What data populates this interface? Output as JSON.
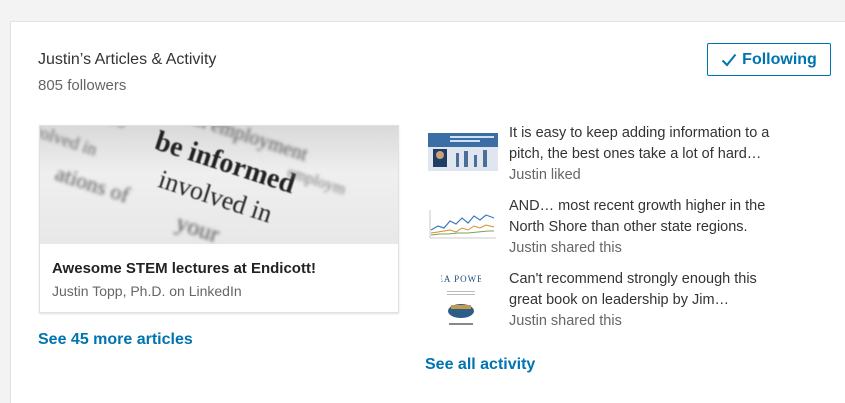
{
  "header": {
    "title": "Justin’s Articles & Activity",
    "followers": "805 followers",
    "follow_button": "Following",
    "follow_icon": "check-icon"
  },
  "featured_article": {
    "image_words": [
      "be informed",
      "involved in",
      "your"
    ],
    "title": "Awesome STEM lectures at Endicott!",
    "author": "Justin Topp, Ph.D. on LinkedIn"
  },
  "see_more_articles": "See 45 more articles",
  "activity": [
    {
      "text_line1": "It is easy to keep adding information to a",
      "text_line2": "pitch, the best ones take a lot of hard…",
      "meta": "Justin liked"
    },
    {
      "text_line1": "AND… most recent growth higher in the",
      "text_line2": "North Shore than other state regions.",
      "meta": "Justin shared this"
    },
    {
      "text_line1": "Can't recommend strongly enough this",
      "text_line2": "great book on leadership by Jim…",
      "meta": "Justin shared this",
      "thumb_text": "SEA POWER"
    }
  ],
  "see_all_activity": "See all activity",
  "colors": {
    "accent": "#0073b1",
    "text": "#333333",
    "muted": "#666666"
  }
}
